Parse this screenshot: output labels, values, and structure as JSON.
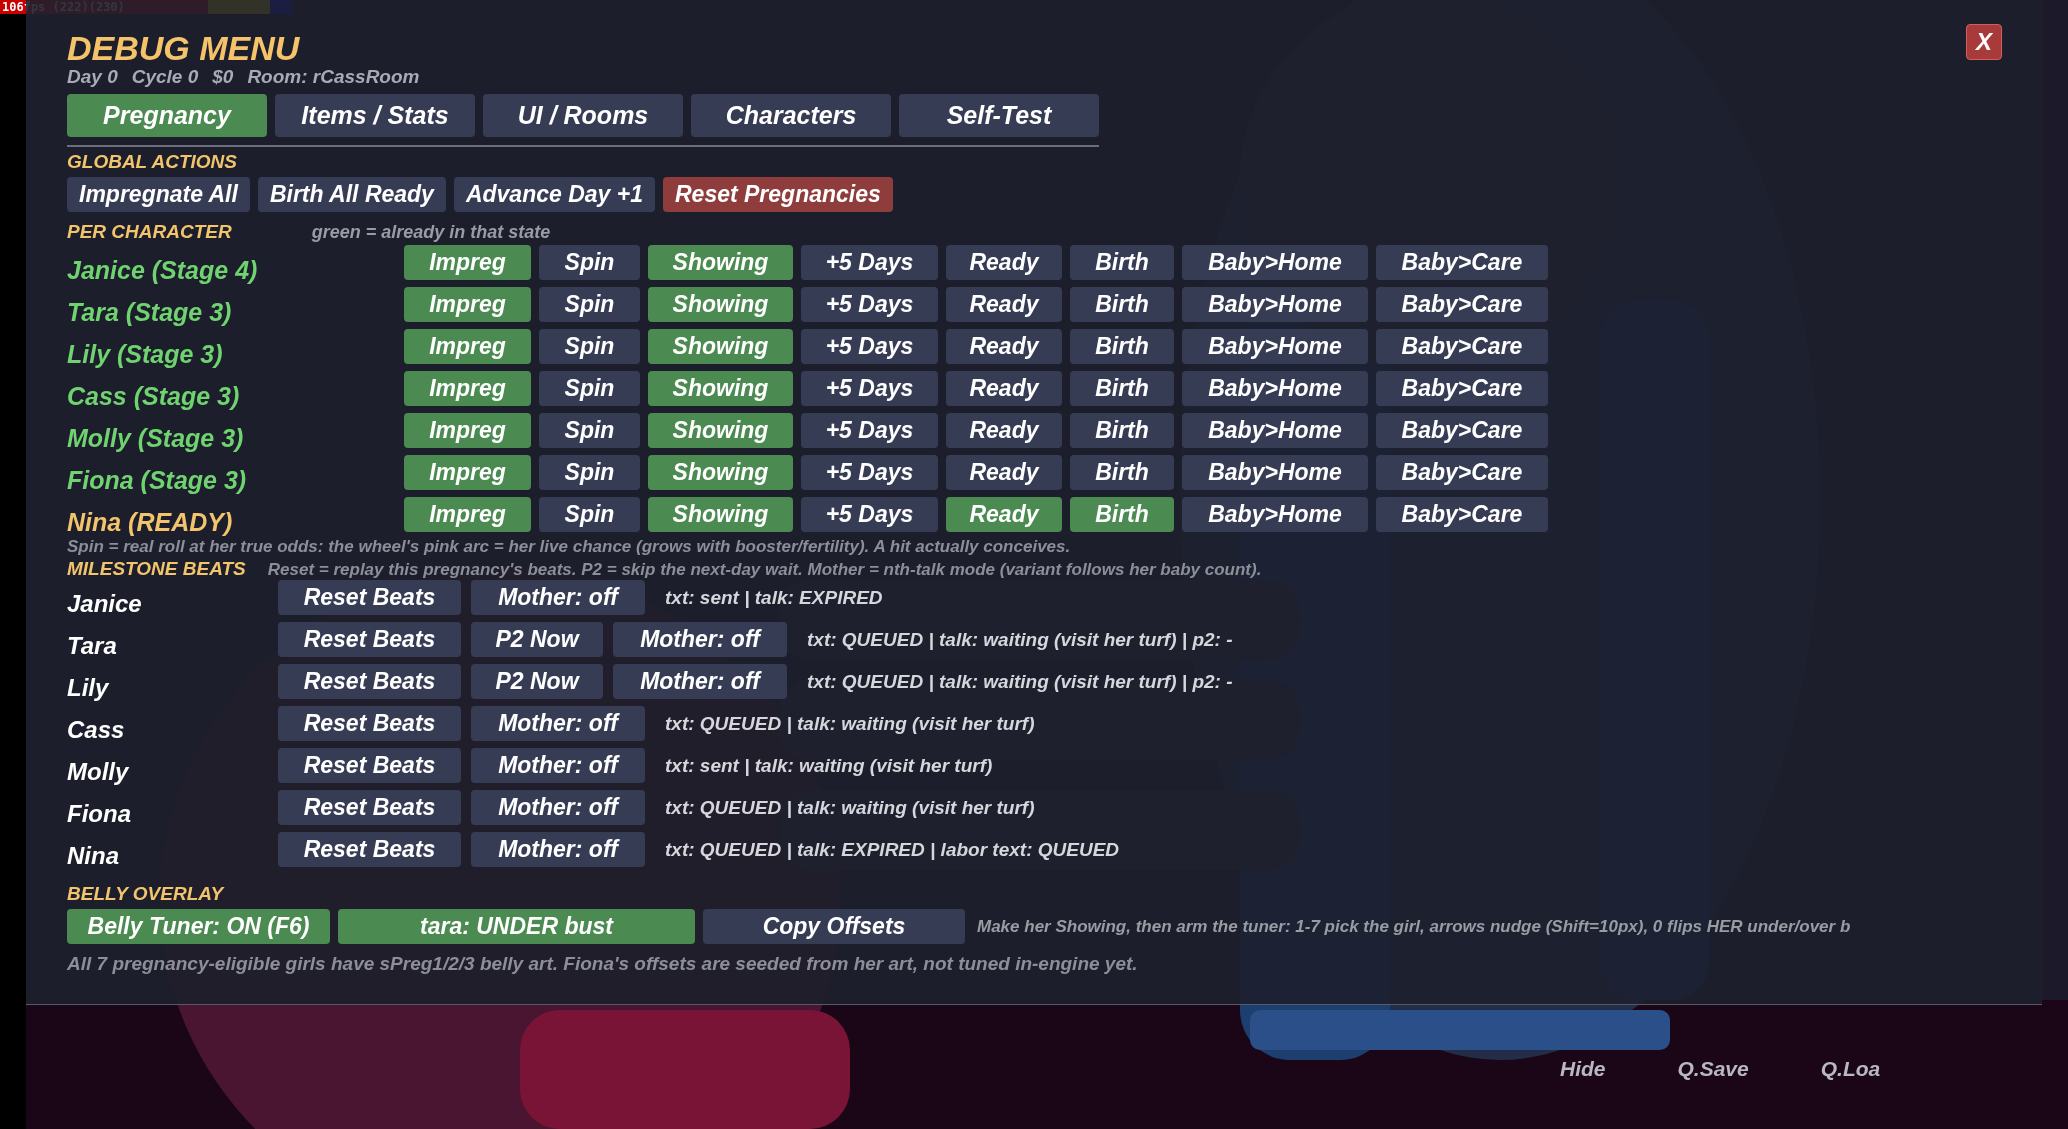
{
  "perf": {
    "fps": "106fps (222)(230)"
  },
  "close": "X",
  "title": "DEBUG MENU",
  "status_line": [
    "Day 0",
    "Cycle 0",
    "$0",
    "Room: rCassRoom"
  ],
  "tabs": [
    {
      "label": "Pregnancy",
      "selected": true
    },
    {
      "label": "Items / Stats",
      "selected": false
    },
    {
      "label": "UI / Rooms",
      "selected": false
    },
    {
      "label": "Characters",
      "selected": false
    },
    {
      "label": "Self-Test",
      "selected": false
    }
  ],
  "global_actions": {
    "heading": "GLOBAL ACTIONS",
    "buttons": [
      {
        "label": "Impregnate All",
        "kind": "normal"
      },
      {
        "label": "Birth All Ready",
        "kind": "normal"
      },
      {
        "label": "Advance Day +1",
        "kind": "normal"
      },
      {
        "label": "Reset Pregnancies",
        "kind": "danger"
      }
    ]
  },
  "per_character": {
    "heading": "PER CHARACTER",
    "hint": "green = already in that state",
    "characters": [
      {
        "name": "Janice  (Stage 4)",
        "ready": false,
        "actions": [
          {
            "label": "Impreg",
            "on": true
          },
          {
            "label": "Spin",
            "on": false
          },
          {
            "label": "Showing",
            "on": true
          },
          {
            "label": "+5 Days",
            "on": false
          },
          {
            "label": "Ready",
            "on": false
          },
          {
            "label": "Birth",
            "on": false
          },
          {
            "label": "Baby>Home",
            "on": false
          },
          {
            "label": "Baby>Care",
            "on": false
          }
        ]
      },
      {
        "name": "Tara  (Stage 3)",
        "ready": false,
        "actions": [
          {
            "label": "Impreg",
            "on": true
          },
          {
            "label": "Spin",
            "on": false
          },
          {
            "label": "Showing",
            "on": true
          },
          {
            "label": "+5 Days",
            "on": false
          },
          {
            "label": "Ready",
            "on": false
          },
          {
            "label": "Birth",
            "on": false
          },
          {
            "label": "Baby>Home",
            "on": false
          },
          {
            "label": "Baby>Care",
            "on": false
          }
        ]
      },
      {
        "name": "Lily  (Stage 3)",
        "ready": false,
        "actions": [
          {
            "label": "Impreg",
            "on": true
          },
          {
            "label": "Spin",
            "on": false
          },
          {
            "label": "Showing",
            "on": true
          },
          {
            "label": "+5 Days",
            "on": false
          },
          {
            "label": "Ready",
            "on": false
          },
          {
            "label": "Birth",
            "on": false
          },
          {
            "label": "Baby>Home",
            "on": false
          },
          {
            "label": "Baby>Care",
            "on": false
          }
        ]
      },
      {
        "name": "Cass  (Stage 3)",
        "ready": false,
        "actions": [
          {
            "label": "Impreg",
            "on": true
          },
          {
            "label": "Spin",
            "on": false
          },
          {
            "label": "Showing",
            "on": true
          },
          {
            "label": "+5 Days",
            "on": false
          },
          {
            "label": "Ready",
            "on": false
          },
          {
            "label": "Birth",
            "on": false
          },
          {
            "label": "Baby>Home",
            "on": false
          },
          {
            "label": "Baby>Care",
            "on": false
          }
        ]
      },
      {
        "name": "Molly  (Stage 3)",
        "ready": false,
        "actions": [
          {
            "label": "Impreg",
            "on": true
          },
          {
            "label": "Spin",
            "on": false
          },
          {
            "label": "Showing",
            "on": true
          },
          {
            "label": "+5 Days",
            "on": false
          },
          {
            "label": "Ready",
            "on": false
          },
          {
            "label": "Birth",
            "on": false
          },
          {
            "label": "Baby>Home",
            "on": false
          },
          {
            "label": "Baby>Care",
            "on": false
          }
        ]
      },
      {
        "name": "Fiona  (Stage 3)",
        "ready": false,
        "actions": [
          {
            "label": "Impreg",
            "on": true
          },
          {
            "label": "Spin",
            "on": false
          },
          {
            "label": "Showing",
            "on": true
          },
          {
            "label": "+5 Days",
            "on": false
          },
          {
            "label": "Ready",
            "on": false
          },
          {
            "label": "Birth",
            "on": false
          },
          {
            "label": "Baby>Home",
            "on": false
          },
          {
            "label": "Baby>Care",
            "on": false
          }
        ]
      },
      {
        "name": "Nina  (READY)",
        "ready": true,
        "actions": [
          {
            "label": "Impreg",
            "on": true
          },
          {
            "label": "Spin",
            "on": false
          },
          {
            "label": "Showing",
            "on": true
          },
          {
            "label": "+5 Days",
            "on": false
          },
          {
            "label": "Ready",
            "on": true
          },
          {
            "label": "Birth",
            "on": true
          },
          {
            "label": "Baby>Home",
            "on": false
          },
          {
            "label": "Baby>Care",
            "on": false
          }
        ]
      }
    ]
  },
  "spin_note": "Spin = real roll at her true odds: the wheel's pink arc = her live chance (grows with booster/fertility). A hit actually conceives.",
  "milestone_beats": {
    "heading": "MILESTONE BEATS",
    "note": "Reset = replay this pregnancy's beats. P2 = skip the next-day wait. Mother = nth-talk mode (variant follows her baby count).",
    "rows": [
      {
        "name": "Janice",
        "buttons": [
          {
            "label": "Reset Beats",
            "kind": "reset"
          },
          {
            "label": "Mother: off",
            "kind": "mother"
          }
        ],
        "status": "txt: sent | talk: EXPIRED"
      },
      {
        "name": "Tara",
        "buttons": [
          {
            "label": "Reset Beats",
            "kind": "reset"
          },
          {
            "label": "P2 Now",
            "kind": "p2"
          },
          {
            "label": "Mother: off",
            "kind": "mother"
          }
        ],
        "status": "txt: QUEUED | talk: waiting (visit her turf) | p2: -"
      },
      {
        "name": "Lily",
        "buttons": [
          {
            "label": "Reset Beats",
            "kind": "reset"
          },
          {
            "label": "P2 Now",
            "kind": "p2"
          },
          {
            "label": "Mother: off",
            "kind": "mother"
          }
        ],
        "status": "txt: QUEUED | talk: waiting (visit her turf) | p2: -"
      },
      {
        "name": "Cass",
        "buttons": [
          {
            "label": "Reset Beats",
            "kind": "reset"
          },
          {
            "label": "Mother: off",
            "kind": "mother"
          }
        ],
        "status": "txt: QUEUED | talk: waiting (visit her turf)"
      },
      {
        "name": "Molly",
        "buttons": [
          {
            "label": "Reset Beats",
            "kind": "reset"
          },
          {
            "label": "Mother: off",
            "kind": "mother"
          }
        ],
        "status": "txt: sent | talk: waiting (visit her turf)"
      },
      {
        "name": "Fiona",
        "buttons": [
          {
            "label": "Reset Beats",
            "kind": "reset"
          },
          {
            "label": "Mother: off",
            "kind": "mother"
          }
        ],
        "status": "txt: QUEUED | talk: waiting (visit her turf)"
      },
      {
        "name": "Nina",
        "buttons": [
          {
            "label": "Reset Beats",
            "kind": "reset"
          },
          {
            "label": "Mother: off",
            "kind": "mother"
          }
        ],
        "status": "txt: QUEUED | talk: EXPIRED | labor text: QUEUED"
      }
    ]
  },
  "belly_overlay": {
    "heading": "BELLY OVERLAY",
    "buttons": [
      {
        "label": "Belly Tuner: ON  (F6)",
        "on": true
      },
      {
        "label": "tara: UNDER bust",
        "on": true
      },
      {
        "label": "Copy Offsets",
        "on": false
      }
    ],
    "hint": "Make her Showing, then arm the tuner: 1-7 pick the girl, arrows nudge (Shift=10px), 0 flips HER under/over b",
    "note": "All 7 pregnancy-eligible girls have sPreg1/2/3 belly art. Fiona's offsets are seeded from her art, not tuned in-engine yet."
  },
  "bottom_bar": [
    "Hide",
    "Q.Save",
    "Q.Loa"
  ]
}
